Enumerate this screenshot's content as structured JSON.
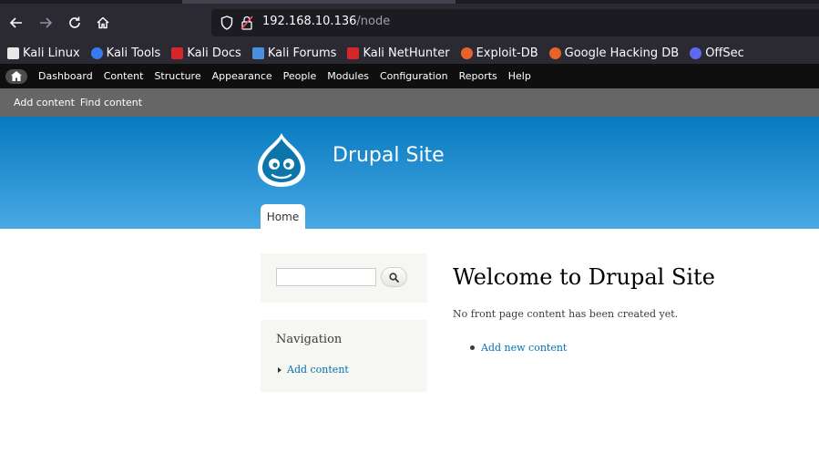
{
  "browser": {
    "url_host": "192.168.10.136",
    "url_path": "/node",
    "bookmarks": [
      {
        "label": "Kali Linux",
        "icon": "kali-dragon-icon",
        "color": "#e8e8e8"
      },
      {
        "label": "Kali Tools",
        "icon": "kali-tools-icon",
        "color": "#367bf0"
      },
      {
        "label": "Kali Docs",
        "icon": "kali-docs-icon",
        "color": "#d6252b"
      },
      {
        "label": "Kali Forums",
        "icon": "kali-forums-icon",
        "color": "#4a8fe0"
      },
      {
        "label": "Kali NetHunter",
        "icon": "kali-nethunter-icon",
        "color": "#d6252b"
      },
      {
        "label": "Exploit-DB",
        "icon": "exploit-db-icon",
        "color": "#e8632b"
      },
      {
        "label": "Google Hacking DB",
        "icon": "ghdb-icon",
        "color": "#e8632b"
      },
      {
        "label": "OffSec",
        "icon": "offsec-icon",
        "color": "#5d6af0"
      }
    ]
  },
  "admin_toolbar": {
    "items": [
      "Dashboard",
      "Content",
      "Structure",
      "Appearance",
      "People",
      "Modules",
      "Configuration",
      "Reports",
      "Help"
    ],
    "shortcuts": [
      "Add content",
      "Find content"
    ]
  },
  "header": {
    "site_name": "Drupal Site",
    "tab_home": "Home"
  },
  "sidebar": {
    "search_value": "",
    "nav_title": "Navigation",
    "nav_link": "Add content"
  },
  "main": {
    "title": "Welcome to Drupal Site",
    "empty_text": "No front page content has been created yet.",
    "link": "Add new content"
  },
  "colors": {
    "header_top": "#0779bf",
    "header_bottom": "#48a9e4",
    "link": "#0071b3"
  }
}
